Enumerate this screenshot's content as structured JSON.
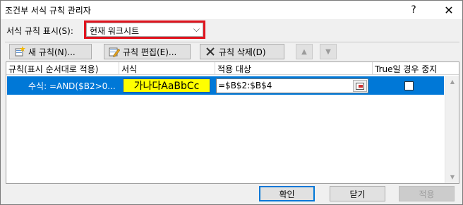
{
  "window": {
    "title": "조건부 서식 규칙 관리자",
    "help_icon": "?",
    "close_icon": "✕"
  },
  "scope": {
    "label": "서식 규칙 표시(S):",
    "selected": "현재 워크시트",
    "highlight_color": "#e0141e"
  },
  "toolbar": {
    "new_rule": "새 규칙(N)...",
    "edit_rule": "규칙 편집(E)...",
    "delete_rule": "규칙 삭제(D)",
    "move_up_icon": "triangle-up-icon",
    "move_down_icon": "triangle-down-icon"
  },
  "grid": {
    "columns": [
      "규칙(표시 순서대로 적용)",
      "서식",
      "적용 대상",
      "True일 경우 중지"
    ],
    "rows": [
      {
        "rule": "수식: =AND($B2>0...",
        "preview": "가나다AaBbCc",
        "preview_bg": "#ffff00",
        "applies_to": "=$B$2:$B$4",
        "stop_if_true": false
      }
    ],
    "selected_row_color": "#0078d7"
  },
  "footer": {
    "ok": "확인",
    "close": "닫기",
    "apply": "적용"
  }
}
